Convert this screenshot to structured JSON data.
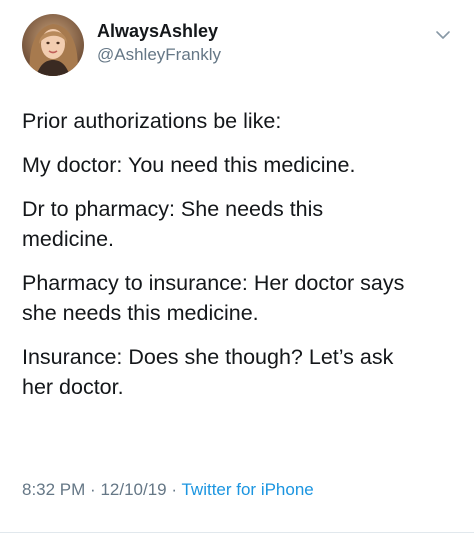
{
  "tweet": {
    "author": {
      "display_name": "AlwaysAshley",
      "handle": "@AshleyFrankly"
    },
    "lines": [
      "Prior authorizations be like:",
      "My doctor: You need this medicine.",
      "Dr to pharmacy: She needs this\nmedicine.",
      "Pharmacy to insurance: Her doctor says\nshe needs this medicine.",
      "Insurance: Does she though? Let’s ask\nher doctor."
    ],
    "meta": {
      "time": "8:32 PM",
      "separator": "·",
      "date": "12/10/19",
      "source": "Twitter for iPhone"
    }
  },
  "icons": {
    "menu": "chevron-down-icon",
    "avatar": "avatar"
  },
  "colors": {
    "text": "#14171a",
    "secondary": "#657786",
    "link": "#1b95e0",
    "divider": "#e1e8ed"
  }
}
